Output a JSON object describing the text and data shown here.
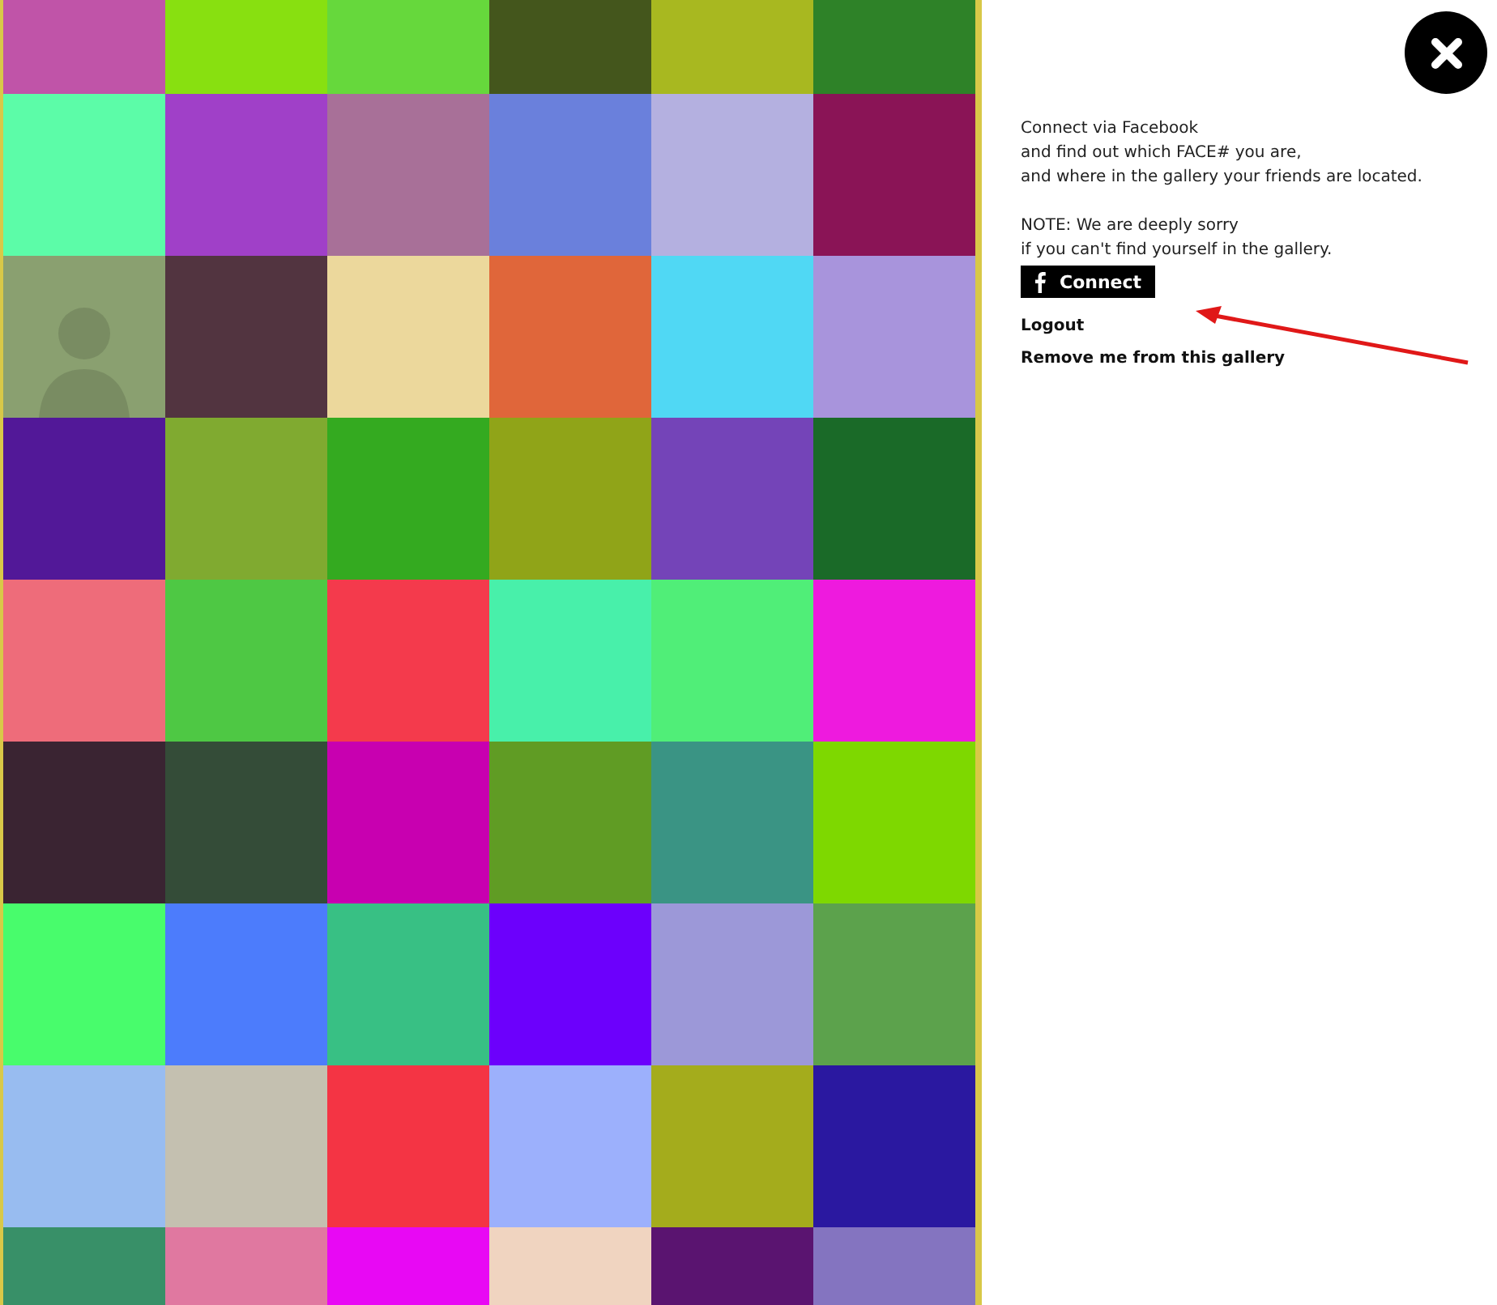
{
  "gallery": {
    "tiles": [
      {
        "kind": "tile",
        "color": "#c054a8"
      },
      {
        "kind": "tile",
        "color": "#88e010"
      },
      {
        "kind": "tile",
        "color": "#66d83c"
      },
      {
        "kind": "tile",
        "color": "#44561c"
      },
      {
        "kind": "tile",
        "color": "#a8b820"
      },
      {
        "kind": "tile",
        "color": "#2e8228"
      },
      {
        "kind": "tile",
        "color": "#5cfca8"
      },
      {
        "kind": "tile",
        "color": "#a040c8"
      },
      {
        "kind": "tile",
        "color": "#a87098"
      },
      {
        "kind": "tile",
        "color": "#6a80dc"
      },
      {
        "kind": "tile",
        "color": "#b4b0e0"
      },
      {
        "kind": "tile",
        "color": "#8a1456"
      },
      {
        "kind": "photo",
        "color": "#8aa070"
      },
      {
        "kind": "tile",
        "color": "#523440"
      },
      {
        "kind": "tile",
        "color": "#ecd89c"
      },
      {
        "kind": "tile",
        "color": "#e0663a"
      },
      {
        "kind": "tile",
        "color": "#50d8f4"
      },
      {
        "kind": "tile",
        "color": "#a894dc"
      },
      {
        "kind": "tile",
        "color": "#521898"
      },
      {
        "kind": "tile",
        "color": "#80aa30"
      },
      {
        "kind": "tile",
        "color": "#34aa20"
      },
      {
        "kind": "tile",
        "color": "#90a418"
      },
      {
        "kind": "tile",
        "color": "#7444b8"
      },
      {
        "kind": "tile",
        "color": "#1a6a28"
      },
      {
        "kind": "tile",
        "color": "#ee6c7a"
      },
      {
        "kind": "tile",
        "color": "#4ec844"
      },
      {
        "kind": "tile",
        "color": "#f43a4c"
      },
      {
        "kind": "tile",
        "color": "#48f0aa"
      },
      {
        "kind": "tile",
        "color": "#50ee78"
      },
      {
        "kind": "tile",
        "color": "#ee1ade"
      },
      {
        "kind": "tile",
        "color": "#3a2432"
      },
      {
        "kind": "tile",
        "color": "#344c38"
      },
      {
        "kind": "tile",
        "color": "#c800b0"
      },
      {
        "kind": "tile",
        "color": "#609c24"
      },
      {
        "kind": "tile",
        "color": "#3a9484"
      },
      {
        "kind": "tile",
        "color": "#7ed800"
      },
      {
        "kind": "tile",
        "color": "#48fc6c"
      },
      {
        "kind": "tile",
        "color": "#4c7cfc"
      },
      {
        "kind": "tile",
        "color": "#38c084"
      },
      {
        "kind": "tile",
        "color": "#6c00fc"
      },
      {
        "kind": "tile",
        "color": "#9c98d8"
      },
      {
        "kind": "tile",
        "color": "#5ca24c"
      },
      {
        "kind": "tile",
        "color": "#98bcf0"
      },
      {
        "kind": "tile",
        "color": "#c4c0b0"
      },
      {
        "kind": "tile",
        "color": "#f43444"
      },
      {
        "kind": "tile",
        "color": "#9cb0fc"
      },
      {
        "kind": "tile",
        "color": "#a4ac1c"
      },
      {
        "kind": "tile",
        "color": "#2a18a0"
      },
      {
        "kind": "tile",
        "color": "#389068"
      },
      {
        "kind": "tile",
        "color": "#e078a0"
      },
      {
        "kind": "tile",
        "color": "#e808f4"
      },
      {
        "kind": "tile",
        "color": "#f0d4c0"
      },
      {
        "kind": "tile",
        "color": "#5a1470"
      },
      {
        "kind": "tile",
        "color": "#8474c0"
      }
    ]
  },
  "panel": {
    "intro": [
      "Connect via Facebook",
      "and find out which FACE# you are,",
      "and where in the gallery your friends are located."
    ],
    "note": [
      "NOTE: We are deeply sorry",
      "if you can't find yourself in the gallery."
    ],
    "connect_button": "Connect",
    "links": [
      "Logout",
      "Remove me from this gallery"
    ]
  }
}
